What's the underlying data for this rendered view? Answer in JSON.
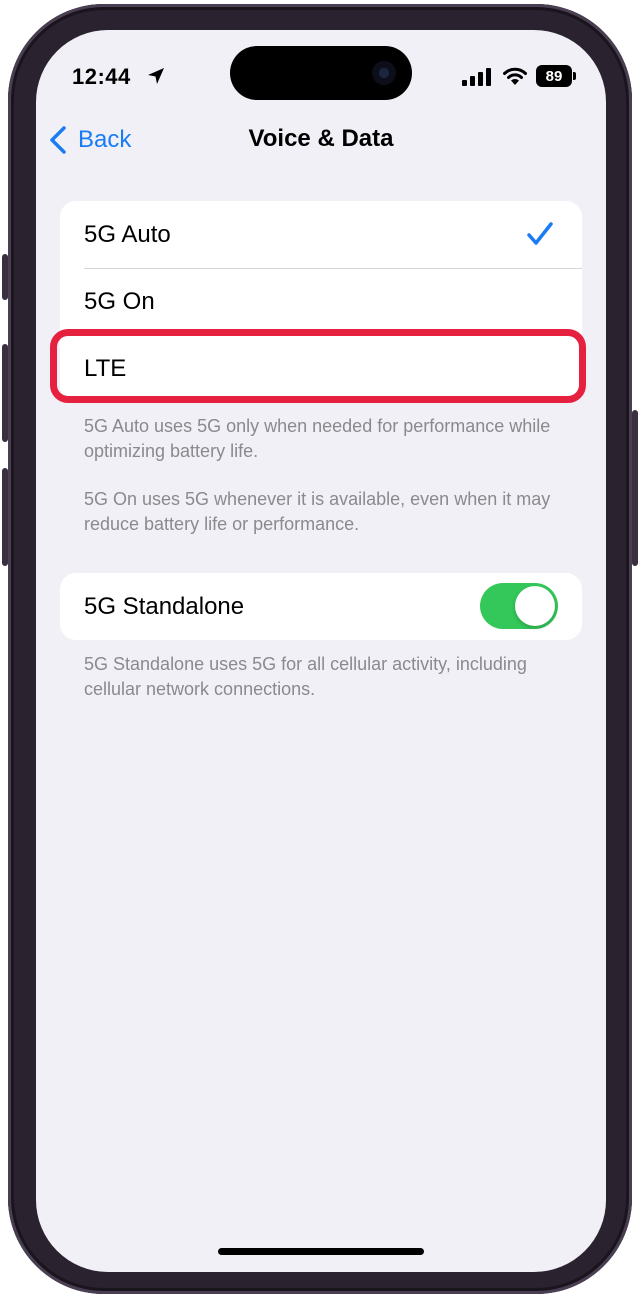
{
  "status_bar": {
    "time": "12:44",
    "battery_level": "89",
    "icons": [
      "location-arrow-icon",
      "cellular-signal-icon",
      "wifi-icon",
      "battery-icon"
    ]
  },
  "nav": {
    "back_label": "Back",
    "title": "Voice & Data"
  },
  "voice_data_options": [
    {
      "label": "5G Auto",
      "selected": true
    },
    {
      "label": "5G On",
      "selected": false
    },
    {
      "label": "LTE",
      "selected": false
    }
  ],
  "option_footnotes": [
    "5G Auto uses 5G only when needed for performance while optimizing battery life.",
    "5G On uses 5G whenever it is available, even when it may reduce battery life or performance."
  ],
  "standalone": {
    "label": "5G Standalone",
    "enabled": true,
    "footnote": "5G Standalone uses 5G for all cellular activity, including cellular network connections."
  },
  "colors": {
    "accent": "#1a7cf5",
    "toggle_on": "#34c759",
    "highlight": "#e5213f",
    "background": "#f1f0f6"
  }
}
